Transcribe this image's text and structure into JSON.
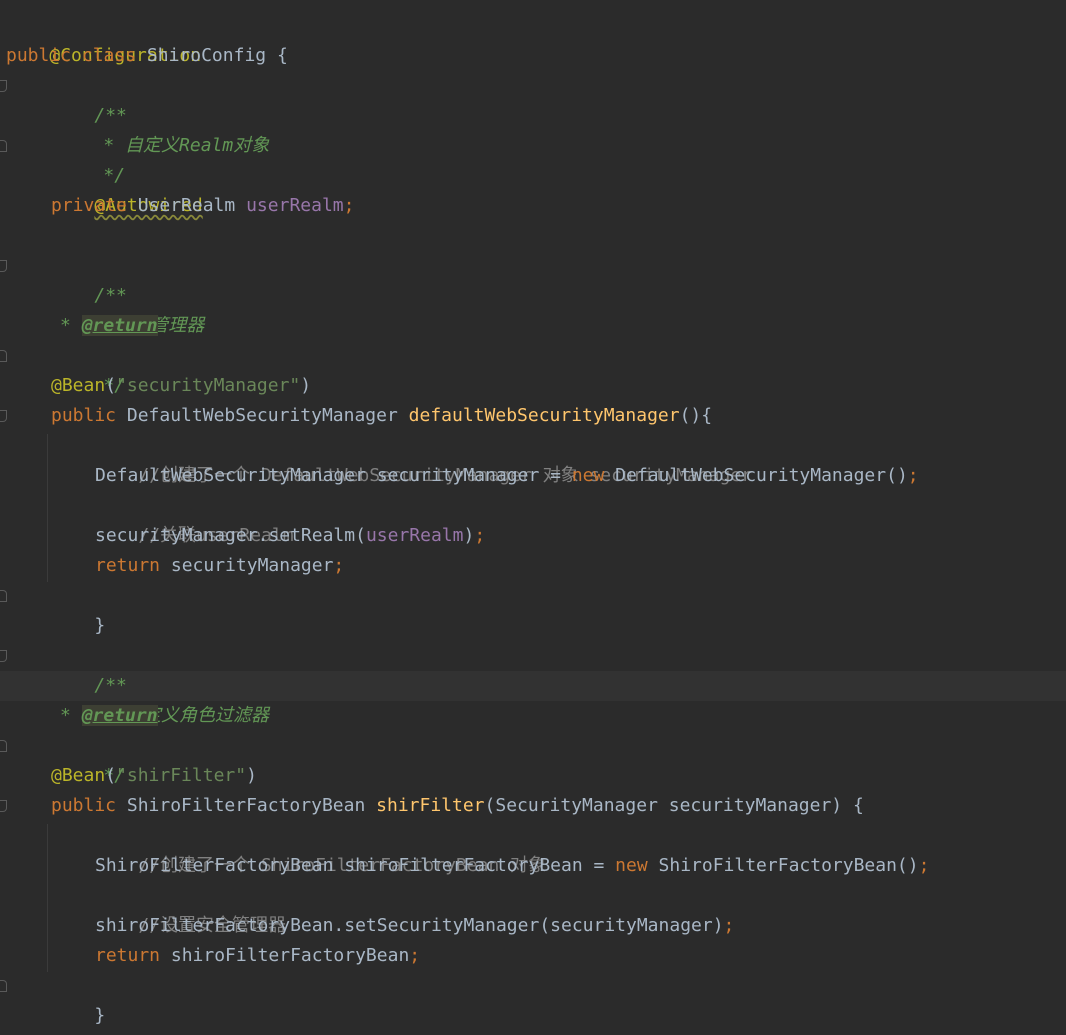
{
  "code": {
    "l1": "@Configuration",
    "l2_kw1": "public",
    "l2_kw2": "class",
    "l2_name": "ShiroConfig {",
    "l3": "/**",
    "l4": "* 自定义Realm对象",
    "l5": "*/",
    "l6": "@Autowired",
    "l7_kw": "private",
    "l7_type": "UserRealm",
    "l7_field": "userRealm",
    "l7_semi": ";",
    "l9": "/**",
    "l10": "*安全管理器",
    "l11_star": "*",
    "l11_tag": "@return",
    "l12": "*/",
    "l13_ann": "@Bean",
    "l13_open": "(",
    "l13_str": "\"securityManager\"",
    "l13_close": ")",
    "l14_kw": "public",
    "l14_type": "DefaultWebSecurityManager",
    "l14_fn": "defaultWebSecurityManager",
    "l14_rest": "(){",
    "l15": "//创建了一个 DefaultWebSecurityManager 对象 securityManager",
    "l16_a": "DefaultWebSecurityManager securityManager = ",
    "l16_kw": "new",
    "l16_b": " DefaultWebSecurityManager()",
    "l16_semi": ";",
    "l17": "//关联userRealm",
    "l18_a": "securityManager.setRealm(",
    "l18_field": "userRealm",
    "l18_b": ")",
    "l18_semi": ";",
    "l19_kw": "return",
    "l19_a": " securityManager",
    "l19_semi": ";",
    "l20": "}",
    "l22": "/**",
    "l23": "* 自定义角色过滤器",
    "l24_star": "*",
    "l24_tag": "@return",
    "l25": "*/",
    "l26_ann": "@Bean",
    "l26_open": "(",
    "l26_str": "\"shirFilter\"",
    "l26_close": ")",
    "l27_kw": "public",
    "l27_type": "ShiroFilterFactoryBean",
    "l27_fn": "shirFilter",
    "l27_rest": "(SecurityManager securityManager) {",
    "l28": "//创建了一个 ShiroFilterFactoryBean 对象",
    "l29_a": "ShiroFilterFactoryBean shiroFilterFactoryBean = ",
    "l29_kw": "new",
    "l29_b": " ShiroFilterFactoryBean()",
    "l29_semi": ";",
    "l30": "//设置安全管理器",
    "l31_a": "shiroFilterFactoryBean.setSecurityManager(securityManager)",
    "l31_semi": ";",
    "l32_kw": "return",
    "l32_a": " shiroFilterFactoryBean",
    "l32_semi": ";",
    "l33": "}"
  },
  "colors": {
    "background": "#2b2b2b",
    "current_line": "#323232",
    "annotation": "#bbb529",
    "keyword": "#cc7832",
    "method": "#ffc66d",
    "field": "#9876aa",
    "string": "#6a8759",
    "doc_comment": "#629755",
    "line_comment": "#808080",
    "text": "#a9b7c6"
  }
}
